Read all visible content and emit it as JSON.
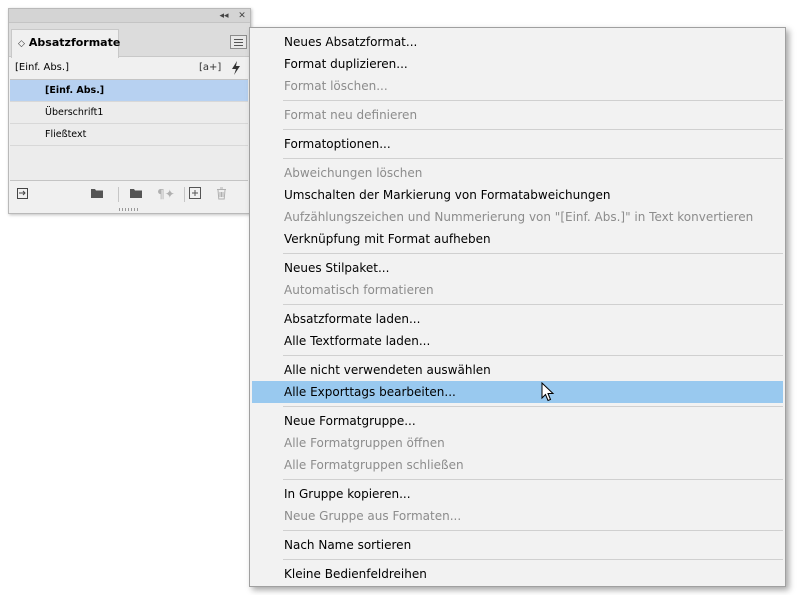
{
  "panel": {
    "tab_label": "Absatzformate",
    "tab_arrows": "◇",
    "current_format": "[Einf. Abs.]",
    "collapse_label": "◂◂",
    "close_label": "✕",
    "new_style_from_selection_icon": "[a+]",
    "quick_apply_icon": "lightning-icon",
    "styles": [
      {
        "label": "[Einf. Abs.]",
        "selected": true
      },
      {
        "label": "Überschrift1",
        "selected": false
      },
      {
        "label": "Fließtext",
        "selected": false
      }
    ]
  },
  "menu": {
    "items": [
      {
        "label": "Neues Absatzformat...",
        "disabled": false,
        "highlighted": false
      },
      {
        "label": "Format duplizieren...",
        "disabled": false,
        "highlighted": false
      },
      {
        "label": "Format löschen...",
        "disabled": true,
        "highlighted": false
      },
      {
        "label": "Format neu definieren",
        "disabled": true,
        "highlighted": false
      },
      {
        "label": "Formatoptionen...",
        "disabled": false,
        "highlighted": false
      },
      {
        "label": "Abweichungen löschen",
        "disabled": true,
        "highlighted": false
      },
      {
        "label": "Umschalten der Markierung von Formatabweichungen",
        "disabled": false,
        "highlighted": false
      },
      {
        "label": "Aufzählungszeichen und Nummerierung von \"[Einf. Abs.]\" in Text konvertieren",
        "disabled": true,
        "highlighted": false
      },
      {
        "label": "Verknüpfung mit Format aufheben",
        "disabled": false,
        "highlighted": false
      },
      {
        "label": "Neues Stilpaket...",
        "disabled": false,
        "highlighted": false
      },
      {
        "label": "Automatisch formatieren",
        "disabled": true,
        "highlighted": false
      },
      {
        "label": "Absatzformate laden...",
        "disabled": false,
        "highlighted": false
      },
      {
        "label": "Alle Textformate laden...",
        "disabled": false,
        "highlighted": false
      },
      {
        "label": "Alle nicht verwendeten auswählen",
        "disabled": false,
        "highlighted": false
      },
      {
        "label": "Alle Exporttags bearbeiten...",
        "disabled": false,
        "highlighted": true
      },
      {
        "label": "Neue Formatgruppe...",
        "disabled": false,
        "highlighted": false
      },
      {
        "label": "Alle Formatgruppen öffnen",
        "disabled": true,
        "highlighted": false
      },
      {
        "label": "Alle Formatgruppen schließen",
        "disabled": true,
        "highlighted": false
      },
      {
        "label": "In Gruppe kopieren...",
        "disabled": false,
        "highlighted": false
      },
      {
        "label": "Neue Gruppe aus Formaten...",
        "disabled": true,
        "highlighted": false
      },
      {
        "label": "Nach Name sortieren",
        "disabled": false,
        "highlighted": false
      },
      {
        "label": "Kleine Bedienfeldreihen",
        "disabled": false,
        "highlighted": false
      }
    ]
  },
  "colors": {
    "selection": "#b7d1f1",
    "menu_highlight": "#99c9ef",
    "disabled_text": "#8c8c8c"
  }
}
